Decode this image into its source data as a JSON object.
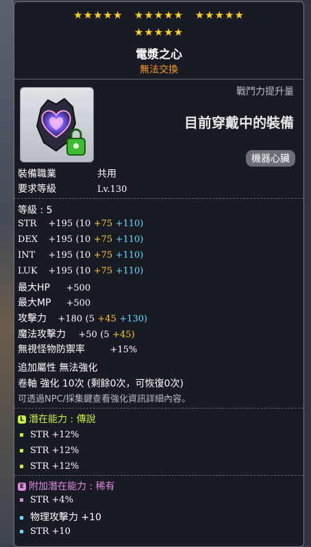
{
  "stars": {
    "groups": [
      "★★★★★",
      "★★★★★",
      "★★★★★",
      "★★★★★"
    ]
  },
  "item": {
    "name": "電漿之心",
    "trade_status": "無法交換",
    "power_label": "戰鬥力提升量",
    "equipped_label": "目前穿戴中的裝備",
    "category_tag": "機器心臟"
  },
  "requirements": [
    {
      "label": "裝備職業",
      "value": "共用"
    },
    {
      "label": "要求等級",
      "value": "Lv.130"
    }
  ],
  "stats": {
    "level": "等級 : 5",
    "lines": [
      {
        "name": "STR",
        "base": "+195",
        "open": "(10",
        "star": "+75",
        "add": "+110)"
      },
      {
        "name": "DEX",
        "base": "+195",
        "open": "(10",
        "star": "+75",
        "add": "+110)"
      },
      {
        "name": "INT",
        "base": "+195",
        "open": "(10",
        "star": "+75",
        "add": "+110)"
      },
      {
        "name": "LUK",
        "base": "+195",
        "open": "(10",
        "star": "+75",
        "add": "+110)"
      }
    ],
    "max_hp": {
      "name": "最大HP",
      "value": "+500"
    },
    "max_mp": {
      "name": "最大MP",
      "value": "+500"
    },
    "attack": {
      "name": "攻擊力",
      "base": "+180",
      "open": "(5",
      "star": "+45",
      "add": "+130)"
    },
    "magic": {
      "name": "魔法攻擊力",
      "base": "+50",
      "open": "(5",
      "star": "+45)"
    },
    "ignore_def": {
      "name": "無視怪物防禦率",
      "value": "+15%"
    }
  },
  "enhance": {
    "extra_attr": "追加屬性 無法強化",
    "scroll": "卷軸 強化 10次 (剩餘0次，可恢復0次)",
    "hint": "可透過NPC/採集鍵查看強化資訊詳細內容。"
  },
  "potential": {
    "badge": "L",
    "title": "潛在能力 : 傳說",
    "lines": [
      "STR +12%",
      "STR +12%",
      "STR +12%"
    ],
    "color": "#c8f03c"
  },
  "bonus_potential": {
    "badge": "E",
    "title": "附加潛在能力 : 稀有",
    "lines": [
      "STR +4%",
      "物理攻擊力 +10",
      "STR +10"
    ],
    "color": "#e08ae0"
  }
}
